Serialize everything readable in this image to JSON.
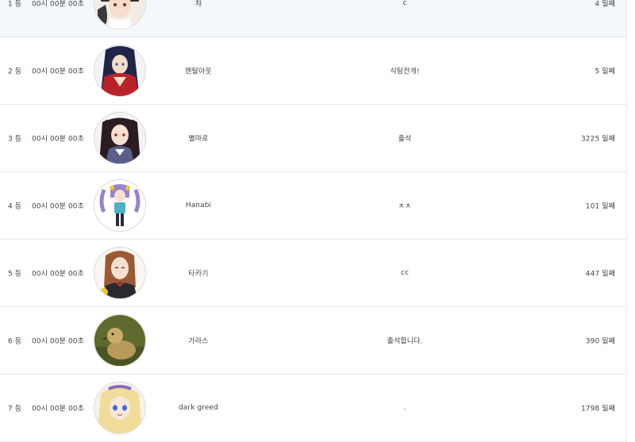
{
  "rows": [
    {
      "rank": "1 등",
      "time": "00시 00분 00초",
      "nickname": "챠",
      "message": "c",
      "days": "4 일째",
      "avatar": "anime-avatar-1",
      "highlight": true
    },
    {
      "rank": "2 등",
      "time": "00시 00분 00초",
      "nickname": "멘탈아웃",
      "message": "식탐전개!",
      "days": "5 일째",
      "avatar": "anime-avatar-2",
      "highlight": false
    },
    {
      "rank": "3 등",
      "time": "00시 00분 00초",
      "nickname": "별마로",
      "message": "출석",
      "days": "3225 일째",
      "avatar": "anime-avatar-3",
      "highlight": false
    },
    {
      "rank": "4 등",
      "time": "00시 00분 00초",
      "nickname": "Hanabi",
      "message": "ㅊㅊ",
      "days": "101 일째",
      "avatar": "anime-avatar-4",
      "highlight": false
    },
    {
      "rank": "5 등",
      "time": "00시 00분 00초",
      "nickname": "타카기",
      "message": "cc",
      "days": "447 일째",
      "avatar": "anime-avatar-5",
      "highlight": false
    },
    {
      "rank": "6 등",
      "time": "00시 00분 00초",
      "nickname": "가라스",
      "message": "출석합니다.",
      "days": "390 일째",
      "avatar": "duckling-avatar",
      "highlight": false
    },
    {
      "rank": "7 등",
      "time": "00시 00분 00초",
      "nickname": "dark greed",
      "message": ".",
      "days": "1798 일째",
      "avatar": "anime-avatar-7",
      "highlight": false
    }
  ],
  "colors": {
    "row_highlight": "#f4f8fd",
    "border": "#e6e9ee",
    "text": "#444444"
  }
}
